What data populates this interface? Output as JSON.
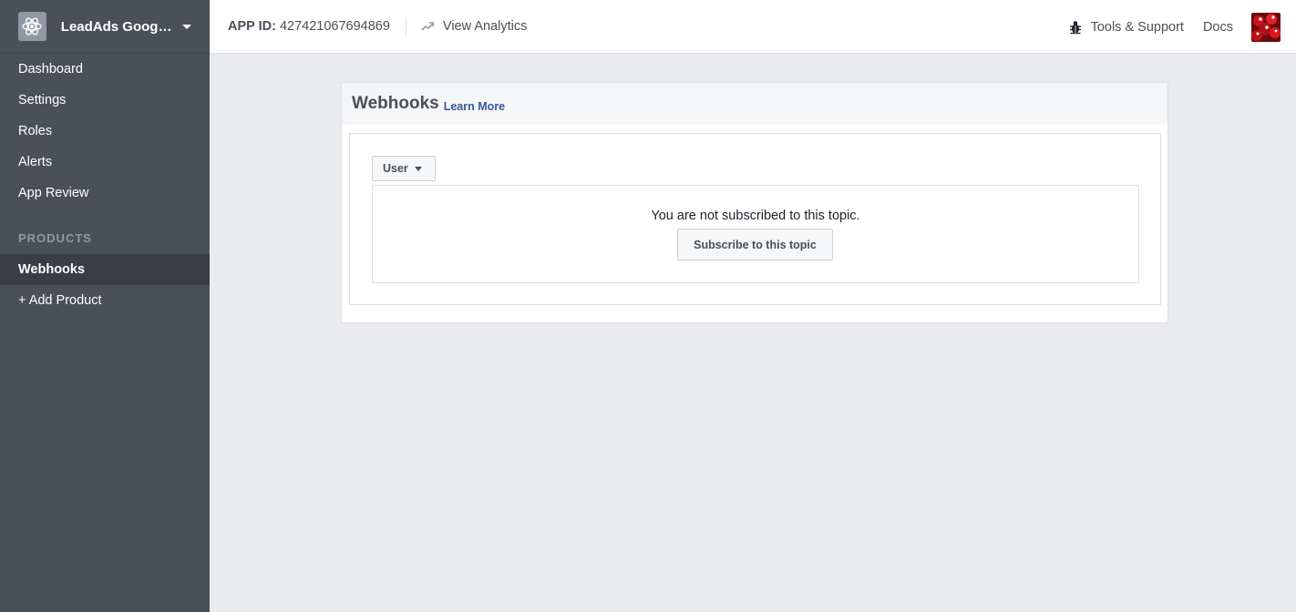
{
  "sidebar": {
    "app_name": "LeadAds Google...",
    "items": [
      {
        "label": "Dashboard"
      },
      {
        "label": "Settings"
      },
      {
        "label": "Roles"
      },
      {
        "label": "Alerts"
      },
      {
        "label": "App Review"
      }
    ],
    "products_label": "PRODUCTS",
    "products": [
      {
        "label": "Webhooks",
        "active": true
      },
      {
        "label": "+ Add Product"
      }
    ]
  },
  "topbar": {
    "app_id_label": "APP ID:",
    "app_id_value": "427421067694869",
    "analytics_label": "View Analytics",
    "tools_label": "Tools & Support",
    "docs_label": "Docs"
  },
  "panel": {
    "title": "Webhooks",
    "learn_more": "Learn More",
    "topic_selected": "User",
    "status_message": "You are not subscribed to this topic.",
    "subscribe_label": "Subscribe to this topic"
  },
  "colors": {
    "sidebar_bg": "#4b4f56",
    "sidebar_active": "#3a3d43",
    "link": "#365899",
    "page_bg": "#e9ebee"
  }
}
